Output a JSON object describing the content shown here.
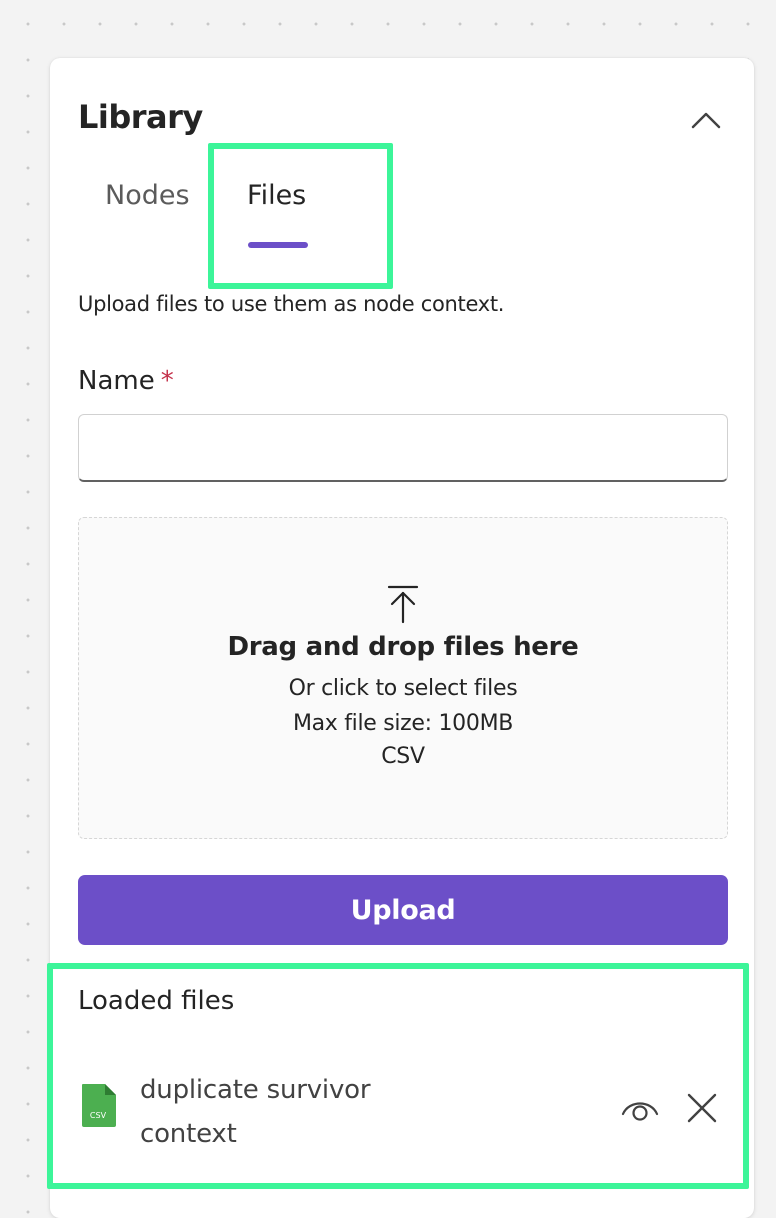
{
  "panel": {
    "title": "Library",
    "collapse_icon": "chevron-up-icon"
  },
  "tabs": [
    {
      "label": "Nodes",
      "selected": false
    },
    {
      "label": "Files",
      "selected": true
    }
  ],
  "files_tab": {
    "description": "Upload files to use them as node context.",
    "name_field": {
      "label": "Name",
      "required_marker": "*",
      "value": "",
      "placeholder": ""
    },
    "dropzone": {
      "icon": "upload-arrow-icon",
      "title": "Drag and drop files here",
      "subtitle": "Or click to select files",
      "max_size": "Max file size: 100MB",
      "accepted_types": "CSV"
    },
    "upload_button": "Upload",
    "loaded_files": {
      "title": "Loaded files",
      "items": [
        {
          "name": "duplicate survivor context",
          "type_badge": "CSV",
          "icon": "csv-file-icon",
          "actions": [
            "eye-icon",
            "close-icon"
          ]
        }
      ]
    }
  },
  "colors": {
    "accent": "#6c4fc8",
    "highlight": "#3cf599",
    "required": "#c4314b",
    "csv_icon": "#4caf50",
    "canvas_background": "#f3f3f3"
  }
}
